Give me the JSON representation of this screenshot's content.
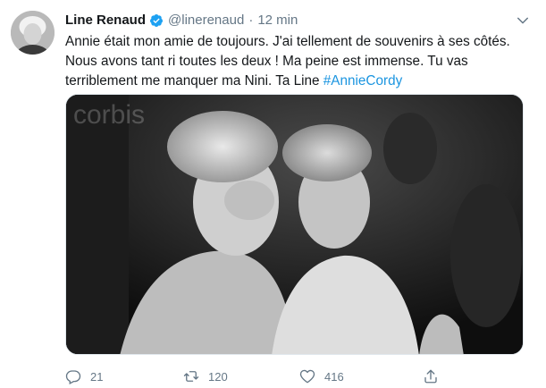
{
  "tweet": {
    "author_name": "Line Renaud",
    "author_handle": "@linerenaud",
    "separator": "·",
    "timestamp": "12 min",
    "text_main": "Annie était mon amie de toujours. J'ai tellement de souvenirs à ses côtés. Nous avons tant ri toutes les deux ! Ma peine est immense. Tu vas terriblement me manquer ma Nini. Ta Line ",
    "hashtag": "#AnnieCordy",
    "photo_watermark": "corbis",
    "counts": {
      "replies": "21",
      "retweets": "120",
      "likes": "416"
    }
  },
  "icons": {
    "verified": "verified-badge-icon",
    "caret": "chevron-down-icon",
    "reply": "reply-icon",
    "retweet": "retweet-icon",
    "like": "heart-icon",
    "share": "share-icon"
  },
  "colors": {
    "text": "#14171a",
    "secondary": "#657786",
    "link": "#1b95e0",
    "verified": "#1da1f2"
  }
}
